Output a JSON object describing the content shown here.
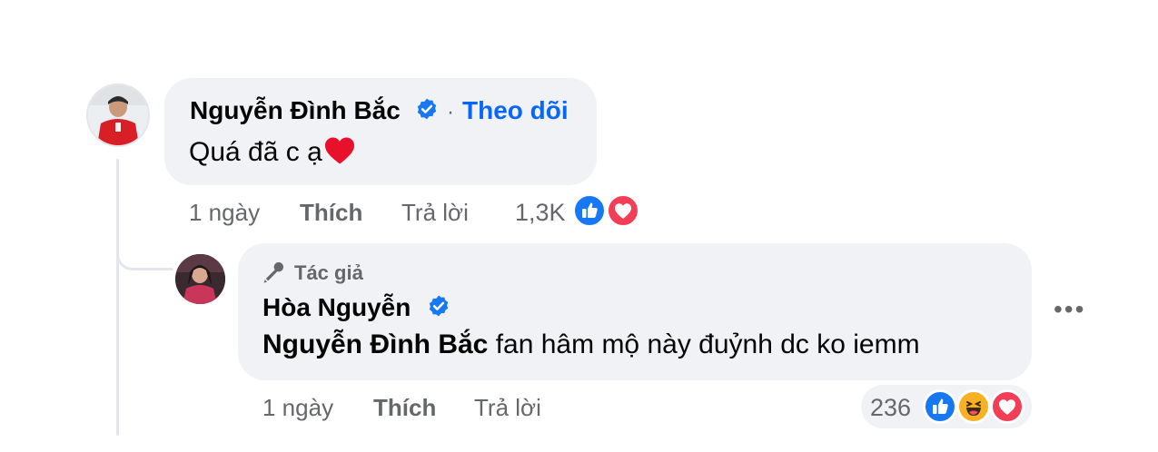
{
  "comment1": {
    "author": "Nguyễn Đình Bắc",
    "follow_label": "Theo dõi",
    "separator": "·",
    "text": "Quá đã c ạ",
    "time": "1 ngày",
    "like_label": "Thích",
    "reply_label": "Trả lời",
    "reaction_count": "1,3K",
    "reactions": [
      "like-icon",
      "love-icon"
    ]
  },
  "comment2": {
    "badge": "Tác giả",
    "author": "Hòa Nguyễn",
    "mention": "Nguyễn Đình Bắc",
    "text": " fan hâm mộ này đuỷnh dc ko iemm",
    "time": "1 ngày",
    "like_label": "Thích",
    "reply_label": "Trả lời",
    "reaction_count": "236",
    "reactions": [
      "like-icon",
      "haha-icon",
      "love-icon"
    ]
  },
  "more_options": "•••",
  "colors": {
    "link": "#0866ff",
    "bubble": "#f0f2f5",
    "muted": "#65676b",
    "like": "#1877f2",
    "love": "#f33e58",
    "haha": "#f7b125"
  }
}
